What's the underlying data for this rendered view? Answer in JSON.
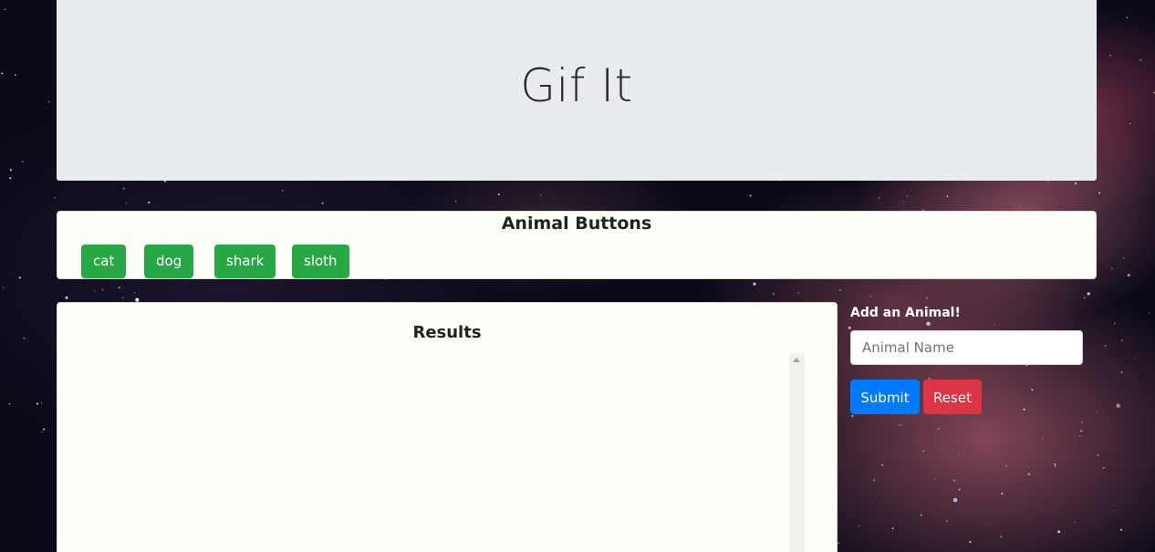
{
  "header": {
    "title": "Gif It"
  },
  "animal_panel": {
    "title": "Animal Buttons",
    "buttons": [
      "cat",
      "dog",
      "shark",
      "sloth"
    ]
  },
  "results": {
    "title": "Results"
  },
  "add_form": {
    "label": "Add an Animal!",
    "input_placeholder": "Animal Name",
    "input_value": "",
    "submit_label": "Submit",
    "reset_label": "Reset"
  },
  "colors": {
    "jumbotron_bg": "#e9ecef",
    "panel_bg": "#fffffa",
    "animal_button": "#28a745",
    "submit_button": "#007bff",
    "reset_button": "#dc3545"
  }
}
